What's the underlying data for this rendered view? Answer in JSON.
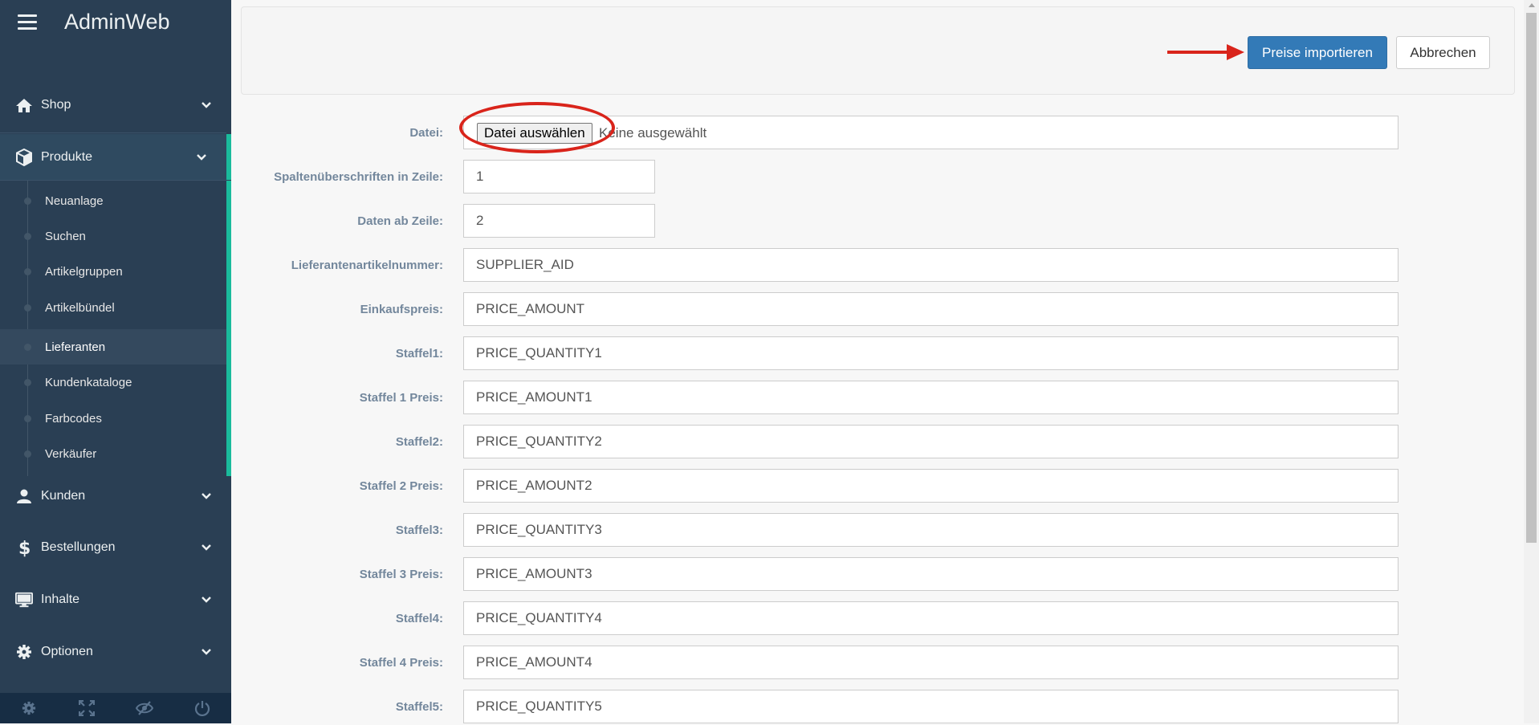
{
  "brand": {
    "title": "AdminWeb"
  },
  "sidebar": {
    "items": [
      {
        "label": "Shop",
        "icon": "home-icon"
      },
      {
        "label": "Produkte",
        "icon": "cube-icon"
      },
      {
        "label": "Kunden",
        "icon": "user-icon"
      },
      {
        "label": "Bestellungen",
        "icon": "dollar-icon"
      },
      {
        "label": "Inhalte",
        "icon": "monitor-icon"
      },
      {
        "label": "Optionen",
        "icon": "gear-icon"
      }
    ],
    "submenu": [
      {
        "label": "Neuanlage"
      },
      {
        "label": "Suchen"
      },
      {
        "label": "Artikelgruppen"
      },
      {
        "label": "Artikelbündel"
      },
      {
        "label": "Lieferanten",
        "active": true
      },
      {
        "label": "Kundenkataloge"
      },
      {
        "label": "Farbcodes"
      },
      {
        "label": "Verkäufer"
      }
    ],
    "footer_icons": [
      "settings-icon",
      "fullscreen-icon",
      "eye-slash-icon",
      "power-icon"
    ]
  },
  "toolbar": {
    "import_label": "Preise importieren",
    "cancel_label": "Abbrechen"
  },
  "form": {
    "file": {
      "label": "Datei:",
      "button": "Datei auswählen",
      "status": "Keine ausgewählt"
    },
    "fields": [
      {
        "label": "Spaltenüberschriften in Zeile:",
        "value": "1"
      },
      {
        "label": "Daten ab Zeile:",
        "value": "2"
      },
      {
        "label": "Lieferantenartikelnummer:",
        "value": "SUPPLIER_AID"
      },
      {
        "label": "Einkaufspreis:",
        "value": "PRICE_AMOUNT"
      },
      {
        "label": "Staffel1:",
        "value": "PRICE_QUANTITY1"
      },
      {
        "label": "Staffel 1 Preis:",
        "value": "PRICE_AMOUNT1"
      },
      {
        "label": "Staffel2:",
        "value": "PRICE_QUANTITY2"
      },
      {
        "label": "Staffel 2 Preis:",
        "value": "PRICE_AMOUNT2"
      },
      {
        "label": "Staffel3:",
        "value": "PRICE_QUANTITY3"
      },
      {
        "label": "Staffel 3 Preis:",
        "value": "PRICE_AMOUNT3"
      },
      {
        "label": "Staffel4:",
        "value": "PRICE_QUANTITY4"
      },
      {
        "label": "Staffel 4 Preis:",
        "value": "PRICE_AMOUNT4"
      },
      {
        "label": "Staffel5:",
        "value": "PRICE_QUANTITY5"
      }
    ]
  },
  "colors": {
    "sidebar_bg": "#2a3f54",
    "accent": "#1abb9c",
    "primary_button": "#337ab7",
    "annotation_red": "#d9241b"
  }
}
